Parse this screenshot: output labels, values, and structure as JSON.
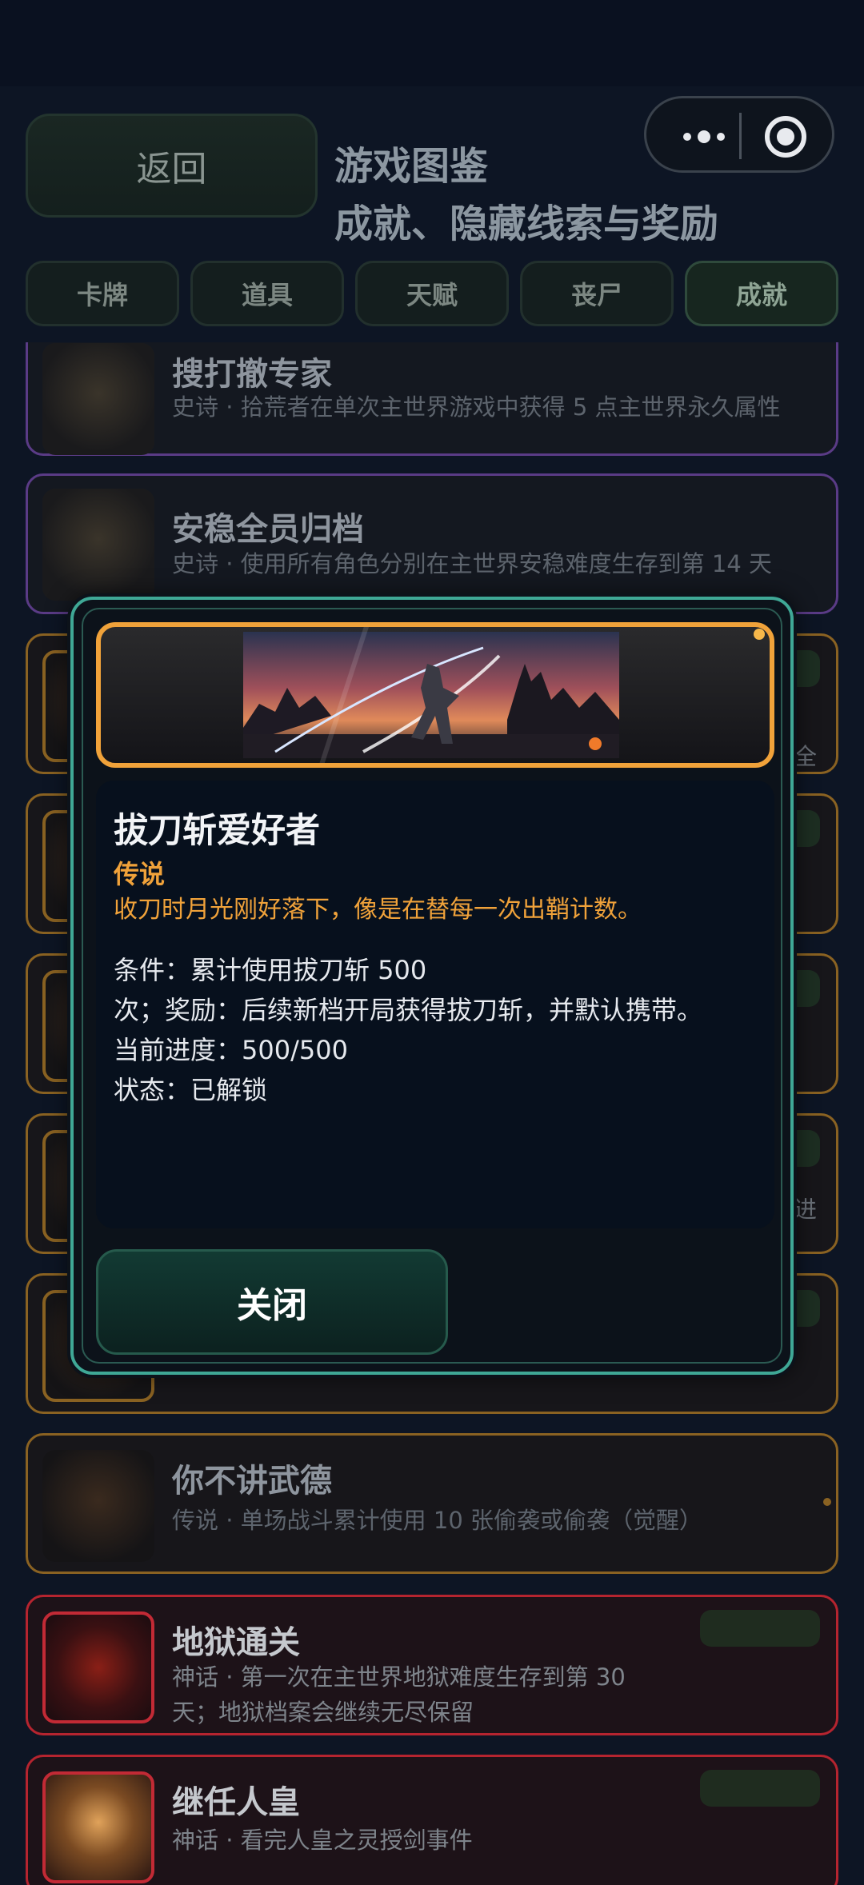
{
  "header": {
    "back_label": "返回",
    "title": "游戏图鉴",
    "subtitle": "成就、隐藏线索与奖励"
  },
  "capsule": {
    "more_icon": "more-dots-icon",
    "target_icon": "target-icon"
  },
  "tabs": [
    {
      "label": "卡牌",
      "active": false
    },
    {
      "label": "道具",
      "active": false
    },
    {
      "label": "天赋",
      "active": false
    },
    {
      "label": "丧尸",
      "active": false
    },
    {
      "label": "成就",
      "active": true
    }
  ],
  "achievements": [
    {
      "name": "搜打撤专家",
      "desc": "史诗 · 拾荒者在单次主世界游戏中获得 5 点主世界永久属性",
      "rarity": "epic"
    },
    {
      "name": "安稳全员归档",
      "desc": "史诗 · 使用所有角色分别在主世界安稳难度生存到第 14 天",
      "rarity": "epic"
    },
    {
      "name": "",
      "desc": "",
      "side_text": "全",
      "rarity": "legend"
    },
    {
      "name": "",
      "desc": "",
      "rarity": "legend"
    },
    {
      "name": "",
      "desc": "",
      "rarity": "legend"
    },
    {
      "name": "",
      "desc": "",
      "side_text": "进",
      "rarity": "legend"
    },
    {
      "name": "",
      "desc": "",
      "rarity": "legend"
    },
    {
      "name": "你不讲武德",
      "desc": "传说 · 单场战斗累计使用 10 张偷袭或偷袭（觉醒）",
      "rarity": "legend"
    },
    {
      "name": "地狱通关",
      "desc": "神话 · 第一次在主世界地狱难度生存到第 30",
      "desc2": "天；地狱档案会继续无尽保留",
      "rarity": "myth"
    },
    {
      "name": "继任人皇",
      "desc": "神话 · 看完人皇之灵授剑事件",
      "rarity": "myth"
    }
  ],
  "modal": {
    "name": "拔刀斩爱好者",
    "rarity": "传说",
    "flavor": "收刀时月光刚好落下，像是在替每一次出鞘计数。",
    "condition": "条件：累计使用拔刀斩 500",
    "reward": "次；奖励：后续新档开局获得拔刀斩，并默认携带。",
    "progress": "当前进度：500/500",
    "status": "状态：已解锁",
    "close_label": "关闭",
    "border_color": "#3fa896",
    "rarity_color": "#f0a23a"
  }
}
